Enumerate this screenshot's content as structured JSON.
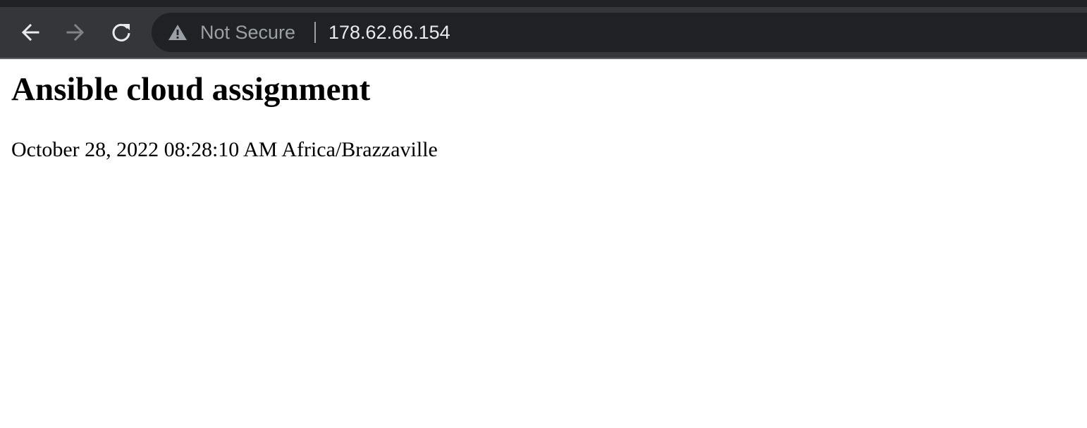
{
  "browser": {
    "security_label": "Not Secure",
    "url": "178.62.66.154",
    "icons": {
      "back": "arrow-left-icon",
      "forward": "arrow-right-icon",
      "reload": "reload-icon",
      "security": "warning-triangle-icon"
    },
    "colors": {
      "chrome": "#35363a",
      "omnibox": "#202124",
      "url_text": "#e8eaed",
      "security_text": "#9aa0a6"
    }
  },
  "page": {
    "title": "Ansible cloud assignment",
    "timestamp": "October 28, 2022 08:28:10 AM Africa/Brazzaville"
  }
}
